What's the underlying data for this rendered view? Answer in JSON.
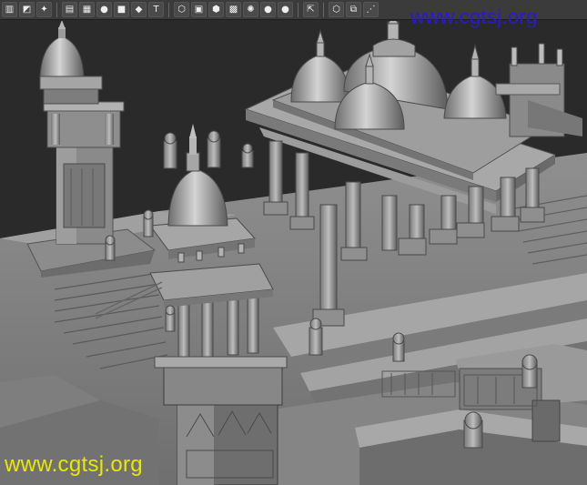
{
  "toolbar": {
    "buttons": [
      {
        "name": "align-icon",
        "glyph": "▥"
      },
      {
        "name": "layer-icon",
        "glyph": "◩"
      },
      {
        "name": "schematic-icon",
        "glyph": "✦"
      },
      {
        "name": "sep"
      },
      {
        "name": "render-setup-icon",
        "glyph": "▤"
      },
      {
        "name": "curve-editor-icon",
        "glyph": "▦"
      },
      {
        "name": "material-sphere-icon",
        "glyph": "●"
      },
      {
        "name": "material-box-icon",
        "glyph": "■"
      },
      {
        "name": "texture-icon",
        "glyph": "◆"
      },
      {
        "name": "text-icon",
        "glyph": "T"
      },
      {
        "name": "sep"
      },
      {
        "name": "wire-box-icon",
        "glyph": "⬡"
      },
      {
        "name": "solid-box-icon",
        "glyph": "▣"
      },
      {
        "name": "shaded-box-icon",
        "glyph": "⬢"
      },
      {
        "name": "checker-icon",
        "glyph": "▩"
      },
      {
        "name": "light-icon",
        "glyph": "✺"
      },
      {
        "name": "shade-sphere-icon",
        "glyph": "●"
      },
      {
        "name": "gold-sphere-icon",
        "glyph": "●"
      },
      {
        "name": "sep"
      },
      {
        "name": "select-icon",
        "glyph": "⇱"
      },
      {
        "name": "sep"
      },
      {
        "name": "cube-icon",
        "glyph": "⬡"
      },
      {
        "name": "window-icon",
        "glyph": "⧉"
      },
      {
        "name": "share-icon",
        "glyph": "⋰"
      }
    ]
  },
  "watermark": {
    "top": "www.cgtsj.org",
    "bottom": "www.cgtsj.org"
  },
  "colors": {
    "background": "#2a2a2a",
    "floor": "#8a8a8a",
    "stone": "#9b9b9b",
    "watermark_top": "#2a18d6",
    "watermark_bottom": "#e8e800"
  }
}
